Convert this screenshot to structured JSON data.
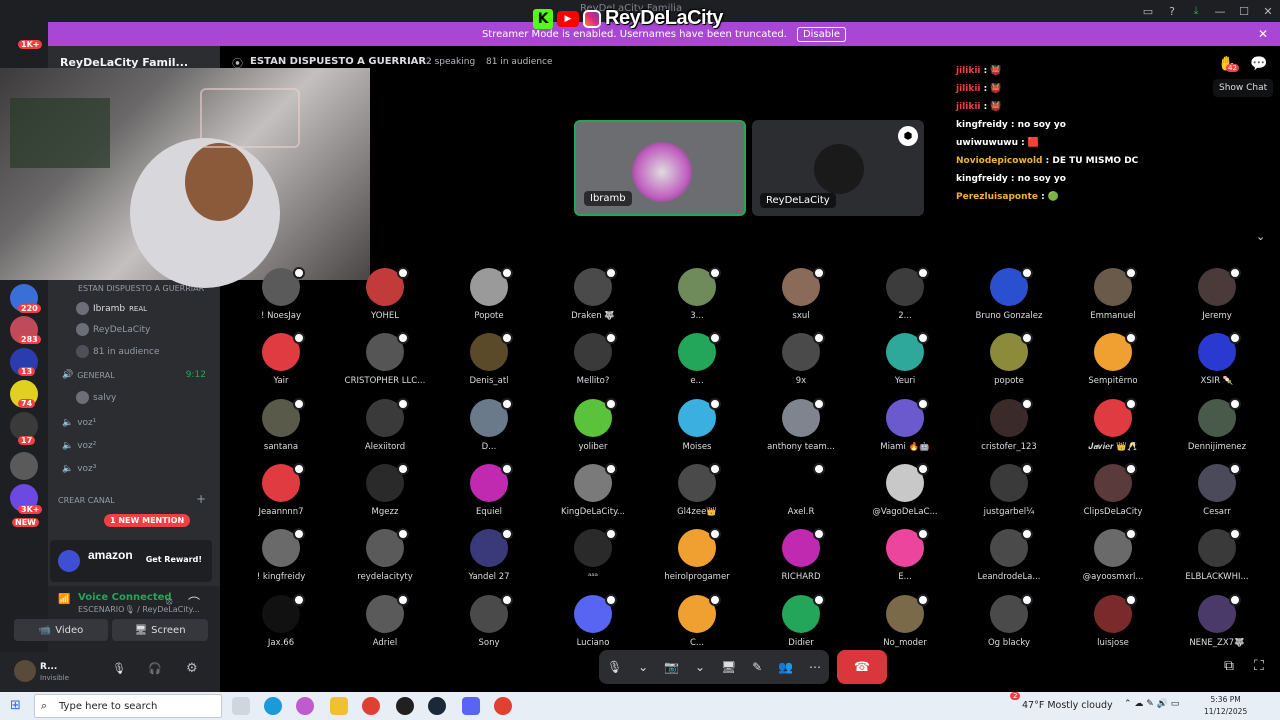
{
  "window": {
    "title": "ReyDeLaCity Familia",
    "controls": [
      "▭",
      "?",
      "⤓",
      "—",
      "☐",
      "✕"
    ]
  },
  "brand_overlay": {
    "name": "ReyDeLaCity",
    "k_letter": "K",
    "yt_glyph": "▶"
  },
  "banner": {
    "text": "Streamer Mode is enabled. Usernames have been truncated.",
    "button": "Disable",
    "close": "✕"
  },
  "rail_badges": [
    "1K+",
    "220",
    "283",
    "13",
    "74",
    "17",
    "3K+",
    "NEW"
  ],
  "sidebar": {
    "server_name": "ReyDeLaCity Famil...",
    "stage_channel_header": "ESTAN DISPUESTO A GUERRIAR",
    "speakers": [
      {
        "name": "Ibramb",
        "tag": "REAL"
      },
      {
        "name": "ReyDeLaCity"
      }
    ],
    "audience_count": "81 in audience",
    "general_label": "GENERAL",
    "general_time": "9:12",
    "general_user": "salvy",
    "voice_channels": [
      "voz¹",
      "voz²",
      "voz³"
    ],
    "create_channel": "CREAR CANAL",
    "new_mention": "1 NEW MENTION",
    "ad": {
      "title": "amazon",
      "button": "Get Reward!"
    },
    "voice": {
      "status": "Voice Connected",
      "location": "ESCENARIO🎙 / ReyDeLaCity...",
      "video_label": "Video",
      "screen_label": "Screen"
    },
    "user": {
      "name": "R...",
      "status": "Invisible"
    }
  },
  "stage": {
    "title": "ESTAN DISPUESTO A GUERRIAR",
    "speaking": "2 speaking",
    "audience": "81 in audience",
    "show_chat_tooltip": "Show Chat",
    "hand_count": "42",
    "speaker_tiles": [
      {
        "name": "Ibramb",
        "active": true
      },
      {
        "name": "ReyDeLaCity",
        "active": false
      }
    ]
  },
  "chat": [
    {
      "user": "jilikii",
      "msg": "👹",
      "color": "#f23f43"
    },
    {
      "user": "jilikii",
      "msg": "👹",
      "color": "#f23f43"
    },
    {
      "user": "jilikii",
      "msg": "👹",
      "color": "#f23f43"
    },
    {
      "user": "kingfreidy",
      "msg": "no soy yo",
      "color": "#ffffff"
    },
    {
      "user": "uwiwuwuwu",
      "msg": "🟥",
      "color": "#ffffff"
    },
    {
      "user": "Noviodepicowold",
      "msg": "DE TU MISMO DC",
      "color": "#f0b232"
    },
    {
      "user": "kingfreidy",
      "msg": "no soy yo",
      "color": "#ffffff"
    },
    {
      "user": "Perezluisaponte",
      "msg": "🟢",
      "color": "#f0b232"
    }
  ],
  "audience": [
    {
      "name": "! NoesJay",
      "color": "#5a5a5a"
    },
    {
      "name": "YOHEL",
      "color": "#c23b3b"
    },
    {
      "name": "Popote",
      "color": "#9a9a9a"
    },
    {
      "name": "Draken 🐺",
      "color": "#4a4a4a"
    },
    {
      "name": "3...",
      "color": "#6f8b5c"
    },
    {
      "name": "sxul",
      "color": "#8a6b5a"
    },
    {
      "name": "2...",
      "color": "#3c3c3c"
    },
    {
      "name": "Bruno Gonzalez",
      "color": "#2a4fcf"
    },
    {
      "name": "Emmanuel",
      "color": "#6a5a4a"
    },
    {
      "name": "Jeremy",
      "color": "#4a3a3a"
    },
    {
      "name": "Yair",
      "color": "#e03b40"
    },
    {
      "name": "CRISTOPHER LLC...",
      "color": "#555"
    },
    {
      "name": "Denis_atl",
      "color": "#5a4a2a"
    },
    {
      "name": "Mellito?",
      "color": "#3a3a3a"
    },
    {
      "name": "e...",
      "color": "#23a55a"
    },
    {
      "name": "9x",
      "color": "#4a4a4a"
    },
    {
      "name": "Yeuri",
      "color": "#2ea89a"
    },
    {
      "name": "popote",
      "color": "#8b8b3b"
    },
    {
      "name": "Sempitërno",
      "color": "#f0a030"
    },
    {
      "name": "XSIR 🍡",
      "color": "#2a3ad0"
    },
    {
      "name": "santana",
      "color": "#5a5a4a"
    },
    {
      "name": "Alexiitord",
      "color": "#3a3a3a"
    },
    {
      "name": "D...",
      "color": "#6a7a8a"
    },
    {
      "name": "yoliber",
      "color": "#5bc23b"
    },
    {
      "name": "Moises",
      "color": "#3bb0e0"
    },
    {
      "name": "anthony team...",
      "color": "#80848e"
    },
    {
      "name": "Miami 🔥🤖",
      "color": "#6a5acd"
    },
    {
      "name": "cristofer_123",
      "color": "#3a2a2a"
    },
    {
      "name": "𝑱𝒂𝒗𝒊𝒆𝒓 👑🥂",
      "color": "#e03b40"
    },
    {
      "name": "Dennijimenez",
      "color": "#4a5a4a"
    },
    {
      "name": "Jeaannnn7",
      "color": "#e03b40"
    },
    {
      "name": "Mgezz",
      "color": "#2a2a2a"
    },
    {
      "name": "Equiel",
      "color": "#c02ab0"
    },
    {
      "name": "KingDeLaCity...",
      "color": "#7a7a7a"
    },
    {
      "name": "Gl4zee👑",
      "color": "#4a4a4a"
    },
    {
      "name": "Axel.R",
      "color": "#000000"
    },
    {
      "name": "@VagoDeLaC...",
      "color": "#c8c8c8"
    },
    {
      "name": "justgarbel¼",
      "color": "#3a3a3a"
    },
    {
      "name": "ClipsDeLaCity",
      "color": "#5a3a3a"
    },
    {
      "name": "Cesarr",
      "color": "#4a4a5a"
    },
    {
      "name": "! kingfreidy",
      "color": "#6a6a6a"
    },
    {
      "name": "reydelacityty",
      "color": "#5a5a5a"
    },
    {
      "name": "Yandel 27",
      "color": "#3a3a7a"
    },
    {
      "name": "ᵃᵃᵃ",
      "color": "#2a2a2a"
    },
    {
      "name": "heirolprogamer",
      "color": "#f0a030"
    },
    {
      "name": "RICHARD",
      "color": "#c02ab0"
    },
    {
      "name": "E...",
      "color": "#eb459e"
    },
    {
      "name": "LeandrodeLa...",
      "color": "#4a4a4a"
    },
    {
      "name": "@ayoosmxrl...",
      "color": "#6a6a6a"
    },
    {
      "name": "ELBLACKWHI...",
      "color": "#3a3a3a"
    },
    {
      "name": "Jax.66",
      "color": "#111111"
    },
    {
      "name": "Adriel",
      "color": "#5a5a5a"
    },
    {
      "name": "Sony",
      "color": "#4a4a4a"
    },
    {
      "name": "Luciano",
      "color": "#5865f2"
    },
    {
      "name": "C...",
      "color": "#f0a030"
    },
    {
      "name": "Didier",
      "color": "#23a55a"
    },
    {
      "name": "No_moder",
      "color": "#7a6a4a"
    },
    {
      "name": "Og blacky",
      "color": "#4a4a4a"
    },
    {
      "name": "luisjose",
      "color": "#7a2a2a"
    },
    {
      "name": "NENE_ZX7🐺",
      "color": "#4a3a6a"
    }
  ],
  "controls": [
    "🎙",
    "⌄",
    "📷",
    "⌄",
    "🖥",
    "✎",
    "👥",
    "⋯"
  ],
  "hangup_glyph": "☎",
  "taskbar": {
    "search_placeholder": "Type here to search",
    "weather": "47°F  Mostly cloudy",
    "time": "5:36 PM",
    "date": "11/12/2025",
    "badge": "2"
  }
}
